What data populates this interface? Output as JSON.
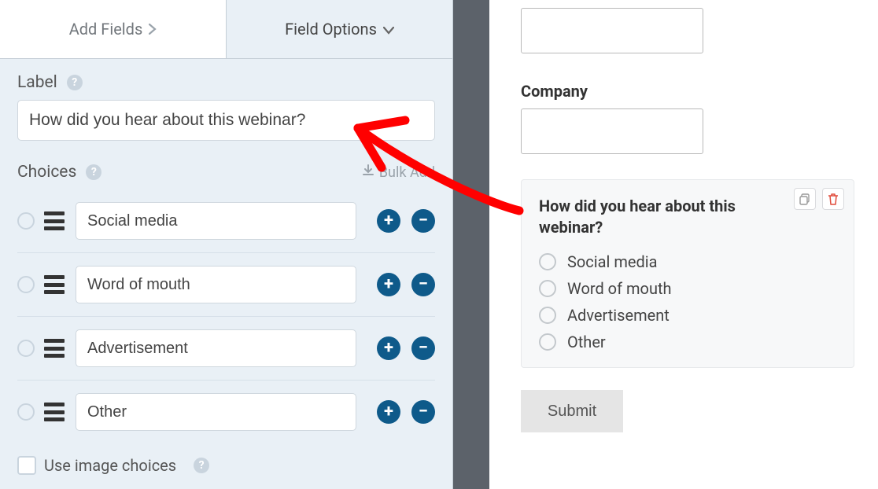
{
  "tabs": {
    "add_fields_label": "Add Fields",
    "field_options_label": "Field Options"
  },
  "label_section": {
    "title": "Label",
    "value": "How did you hear about this webinar?"
  },
  "choices_section": {
    "title": "Choices",
    "bulk_add_label": "Bulk Add",
    "items": [
      {
        "text": "Social media"
      },
      {
        "text": "Word of mouth"
      },
      {
        "text": "Advertisement"
      },
      {
        "text": "Other"
      }
    ],
    "use_image_choices_label": "Use image choices"
  },
  "preview": {
    "company_label": "Company",
    "card_title": "How did you hear about this webinar?",
    "options": [
      "Social media",
      "Word of mouth",
      "Advertisement",
      "Other"
    ],
    "submit_label": "Submit"
  }
}
